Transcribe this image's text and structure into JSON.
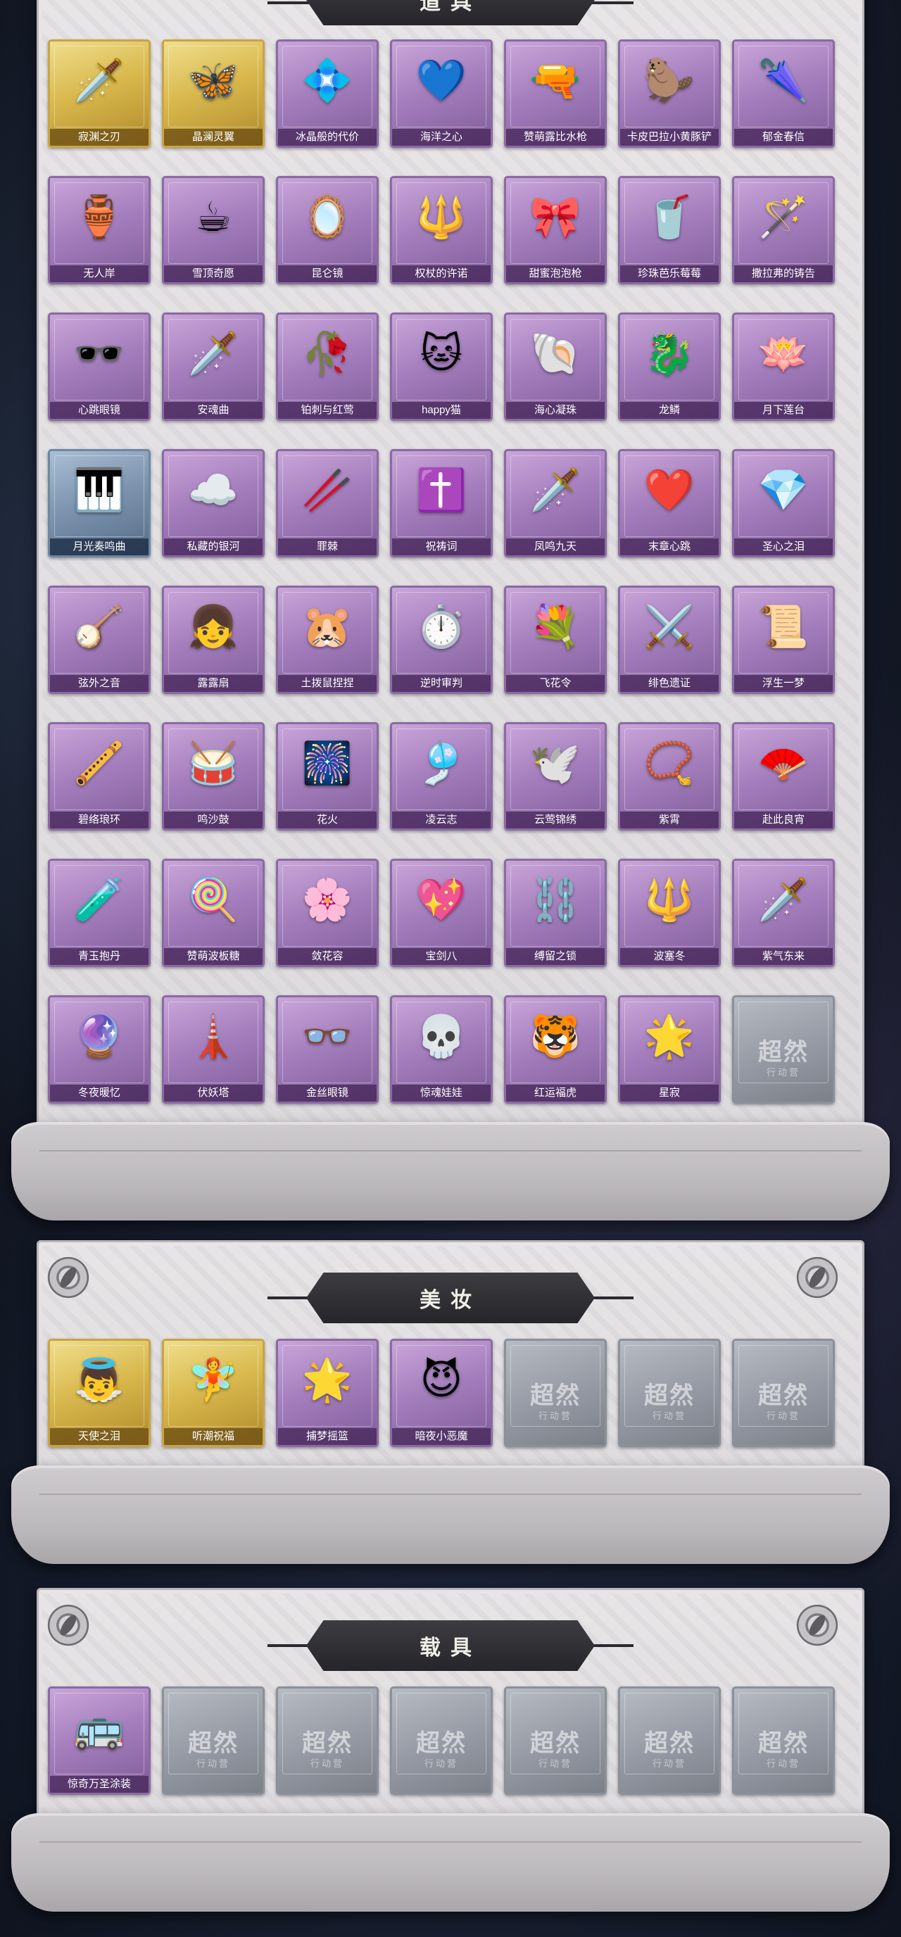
{
  "sections": {
    "props": {
      "title": "道具",
      "items": [
        {
          "name": "寂渊之刃",
          "rarity": "gold",
          "icon": "🗡️"
        },
        {
          "name": "晶澜灵翼",
          "rarity": "gold",
          "icon": "🦋"
        },
        {
          "name": "冰晶般的代价",
          "rarity": "purple",
          "icon": "💠"
        },
        {
          "name": "海洋之心",
          "rarity": "purple",
          "icon": "💙"
        },
        {
          "name": "赞萌露比水枪",
          "rarity": "purple",
          "icon": "🔫"
        },
        {
          "name": "卡皮巴拉小黄豚铲",
          "rarity": "purple",
          "icon": "🦫"
        },
        {
          "name": "郁金春信",
          "rarity": "purple",
          "icon": "🌂"
        },
        {
          "name": "无人岸",
          "rarity": "purple",
          "icon": "🏺"
        },
        {
          "name": "雪顶奇愿",
          "rarity": "purple",
          "icon": "☕"
        },
        {
          "name": "昆仑镜",
          "rarity": "purple",
          "icon": "🪞"
        },
        {
          "name": "权杖的许诺",
          "rarity": "purple",
          "icon": "🔱"
        },
        {
          "name": "甜蜜泡泡枪",
          "rarity": "purple",
          "icon": "🎀"
        },
        {
          "name": "珍珠芭乐莓莓",
          "rarity": "purple",
          "icon": "🥤"
        },
        {
          "name": "撒拉弗的铸告",
          "rarity": "purple",
          "icon": "🪄"
        },
        {
          "name": "心跳眼镜",
          "rarity": "purple",
          "icon": "🕶️"
        },
        {
          "name": "安魂曲",
          "rarity": "purple",
          "icon": "🗡️"
        },
        {
          "name": "铂刺与红莺",
          "rarity": "purple",
          "icon": "🥀"
        },
        {
          "name": "happy猫",
          "rarity": "purple",
          "icon": "🐱"
        },
        {
          "name": "海心凝珠",
          "rarity": "purple",
          "icon": "🐚"
        },
        {
          "name": "龙鳞",
          "rarity": "purple",
          "icon": "🐉"
        },
        {
          "name": "月下莲台",
          "rarity": "purple",
          "icon": "🪷"
        },
        {
          "name": "月光奏鸣曲",
          "rarity": "blue",
          "icon": "🎹"
        },
        {
          "name": "私藏的银河",
          "rarity": "purple",
          "icon": "☁️"
        },
        {
          "name": "罪棘",
          "rarity": "purple",
          "icon": "🥢"
        },
        {
          "name": "祝祷词",
          "rarity": "purple",
          "icon": "✝️"
        },
        {
          "name": "凤鸣九天",
          "rarity": "purple",
          "icon": "🗡️"
        },
        {
          "name": "末章心跳",
          "rarity": "purple",
          "icon": "❤️"
        },
        {
          "name": "圣心之泪",
          "rarity": "purple",
          "icon": "💎"
        },
        {
          "name": "弦外之音",
          "rarity": "purple",
          "icon": "🪕"
        },
        {
          "name": "露露扇",
          "rarity": "purple",
          "icon": "👧"
        },
        {
          "name": "土拨鼠捏捏",
          "rarity": "purple",
          "icon": "🐹"
        },
        {
          "name": "逆时审判",
          "rarity": "purple",
          "icon": "⏱️"
        },
        {
          "name": "飞花令",
          "rarity": "purple",
          "icon": "💐"
        },
        {
          "name": "绯色遗证",
          "rarity": "purple",
          "icon": "⚔️"
        },
        {
          "name": "浮生一梦",
          "rarity": "purple",
          "icon": "📜"
        },
        {
          "name": "碧络琅环",
          "rarity": "purple",
          "icon": "🪈"
        },
        {
          "name": "鸣沙鼓",
          "rarity": "purple",
          "icon": "🥁"
        },
        {
          "name": "花火",
          "rarity": "purple",
          "icon": "🎆"
        },
        {
          "name": "凌云志",
          "rarity": "purple",
          "icon": "🎐"
        },
        {
          "name": "云莺锦绣",
          "rarity": "purple",
          "icon": "🕊️"
        },
        {
          "name": "紫霄",
          "rarity": "purple",
          "icon": "📿"
        },
        {
          "name": "赴此良宵",
          "rarity": "purple",
          "icon": "🪭"
        },
        {
          "name": "青玉抱丹",
          "rarity": "purple",
          "icon": "🧪"
        },
        {
          "name": "赞萌波板糖",
          "rarity": "purple",
          "icon": "🍭"
        },
        {
          "name": "敛花容",
          "rarity": "purple",
          "icon": "🌸"
        },
        {
          "name": "宝剑八",
          "rarity": "purple",
          "icon": "💖"
        },
        {
          "name": "缚留之锁",
          "rarity": "purple",
          "icon": "⛓️"
        },
        {
          "name": "波塞冬",
          "rarity": "purple",
          "icon": "🔱"
        },
        {
          "name": "紫气东来",
          "rarity": "purple",
          "icon": "🗡️"
        },
        {
          "name": "冬夜暖忆",
          "rarity": "purple",
          "icon": "🔮"
        },
        {
          "name": "伏妖塔",
          "rarity": "purple",
          "icon": "🗼"
        },
        {
          "name": "金丝眼镜",
          "rarity": "purple",
          "icon": "👓"
        },
        {
          "name": "惊魂娃娃",
          "rarity": "purple",
          "icon": "💀"
        },
        {
          "name": "红运福虎",
          "rarity": "purple",
          "icon": "🐯"
        },
        {
          "name": "星寂",
          "rarity": "purple",
          "icon": "🌟"
        },
        {
          "name": "",
          "rarity": "locked",
          "icon": ""
        }
      ]
    },
    "makeup": {
      "title": "美妆",
      "items": [
        {
          "name": "天使之泪",
          "rarity": "gold",
          "icon": "👼"
        },
        {
          "name": "听潮祝福",
          "rarity": "gold",
          "icon": "🧚"
        },
        {
          "name": "捕梦摇篮",
          "rarity": "purple",
          "icon": "🌟"
        },
        {
          "name": "暗夜小恶魔",
          "rarity": "purple",
          "icon": "😈"
        },
        {
          "name": "",
          "rarity": "locked",
          "icon": ""
        },
        {
          "name": "",
          "rarity": "locked",
          "icon": ""
        },
        {
          "name": "",
          "rarity": "locked",
          "icon": ""
        }
      ]
    },
    "vehicles": {
      "title": "载具",
      "items": [
        {
          "name": "惊奇万圣涂装",
          "rarity": "purple",
          "icon": "🚌"
        },
        {
          "name": "",
          "rarity": "locked",
          "icon": ""
        },
        {
          "name": "",
          "rarity": "locked",
          "icon": ""
        },
        {
          "name": "",
          "rarity": "locked",
          "icon": ""
        },
        {
          "name": "",
          "rarity": "locked",
          "icon": ""
        },
        {
          "name": "",
          "rarity": "locked",
          "icon": ""
        },
        {
          "name": "",
          "rarity": "locked",
          "icon": ""
        }
      ]
    }
  },
  "locked_watermark": {
    "main": "超然",
    "sub": "行动营"
  }
}
